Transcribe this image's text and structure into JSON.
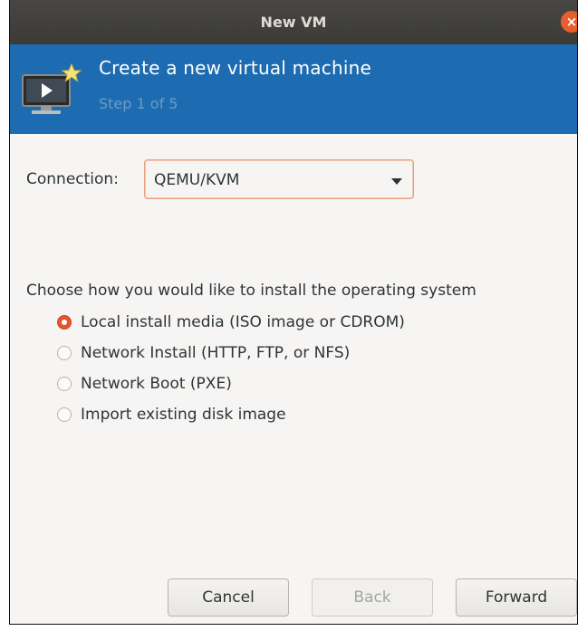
{
  "window": {
    "title": "New VM",
    "close_glyph": "×"
  },
  "header": {
    "title": "Create a new virtual machine",
    "step": "Step 1 of 5",
    "icon": "virtual-machine-icon"
  },
  "connection": {
    "label": "Connection:",
    "value": "QEMU/KVM"
  },
  "install": {
    "prompt": "Choose how you would like to install the operating system",
    "options": [
      {
        "label": "Local install media (ISO image or CDROM)",
        "selected": true
      },
      {
        "label": "Network Install (HTTP, FTP, or NFS)",
        "selected": false
      },
      {
        "label": "Network Boot (PXE)",
        "selected": false
      },
      {
        "label": "Import existing disk image",
        "selected": false
      }
    ]
  },
  "buttons": {
    "cancel": "Cancel",
    "back": "Back",
    "forward": "Forward"
  },
  "colors": {
    "header_bg": "#1d6bb0",
    "accent": "#e4572e",
    "titlebar_bg": "#3b3a37"
  }
}
